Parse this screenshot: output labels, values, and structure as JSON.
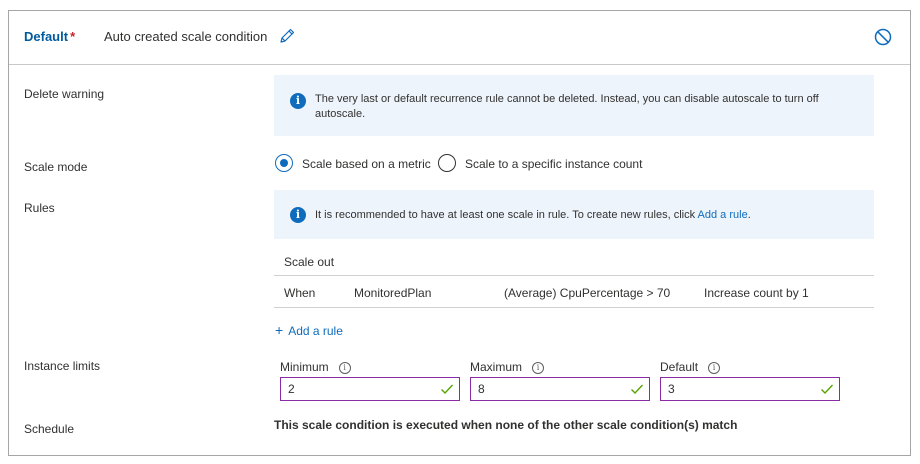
{
  "header": {
    "default_label": "Default",
    "required_mark": "*",
    "condition_name": "Auto created scale condition"
  },
  "delete_warning": {
    "label": "Delete warning",
    "text": "The very last or default recurrence rule cannot be deleted. Instead, you can disable autoscale to turn off autoscale."
  },
  "scale_mode": {
    "label": "Scale mode",
    "options": [
      {
        "label": "Scale based on a metric",
        "selected": true
      },
      {
        "label": "Scale to a specific instance count",
        "selected": false
      }
    ]
  },
  "rules": {
    "label": "Rules",
    "info_text": "It is recommended to have at least one scale in rule. To create new rules, click ",
    "info_link": "Add a rule",
    "info_suffix": ".",
    "table_header": "Scale out",
    "row": {
      "when": "When",
      "resource": "MonitoredPlan",
      "metric": "(Average) CpuPercentage > 70",
      "action": "Increase count by 1"
    },
    "add_rule_label": "Add a rule"
  },
  "instance_limits": {
    "label": "Instance limits",
    "minimum": {
      "label": "Minimum",
      "value": "2"
    },
    "maximum": {
      "label": "Maximum",
      "value": "8"
    },
    "default": {
      "label": "Default",
      "value": "3"
    }
  },
  "schedule": {
    "label": "Schedule",
    "text": "This scale condition is executed when none of the other scale condition(s) match"
  },
  "colors": {
    "accent": "#0f6cbd",
    "required": "#c4262e",
    "field_border": "#8a2da5",
    "valid_check": "#57a300",
    "info_bg": "#eef4fb"
  }
}
